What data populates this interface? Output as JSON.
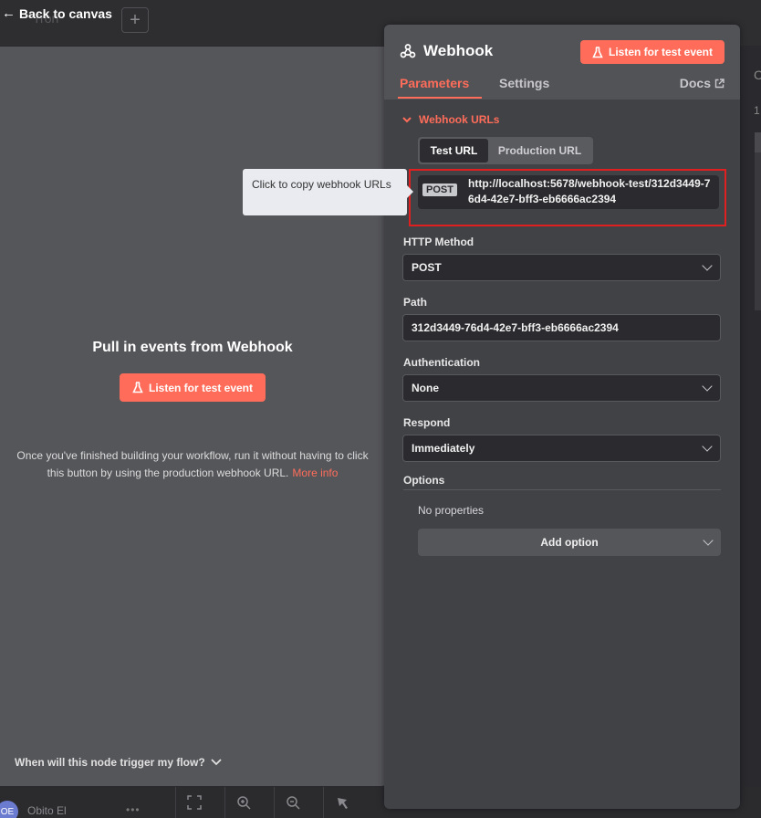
{
  "background": {
    "app_name": "Tron",
    "plus_icon": "plus-icon",
    "right_partial_letter": "C",
    "right_partial_number": "1",
    "user": {
      "initials": "OE",
      "name": "Obito El",
      "menu_icon": "more-dots-icon"
    },
    "canvas_tools": [
      "fit-view-icon",
      "zoom-in-icon",
      "zoom-out-icon",
      "tidy-up-icon"
    ]
  },
  "back_link": {
    "label": "Back to canvas",
    "icon": "arrow-left-icon"
  },
  "input_panel": {
    "title": "Pull in events from Webhook",
    "listen_button": "Listen for test event",
    "info_text": "Once you've finished building your workflow, run it without having to click this button by using the production webhook URL.",
    "more_info_link": "More info",
    "footer_question": "When will this node trigger my flow?"
  },
  "node": {
    "title": "Webhook",
    "icon": "webhook-icon",
    "listen_button": "Listen for test event",
    "tabs": [
      {
        "label": "Parameters",
        "active": true
      },
      {
        "label": "Settings",
        "active": false
      }
    ],
    "docs_label": "Docs",
    "webhook_urls": {
      "section_label": "Webhook URLs",
      "switch_options": [
        "Test URL",
        "Production URL"
      ],
      "selected": "Test URL",
      "method": "POST",
      "url": "http://localhost:5678/webhook-test/312d3449-76d4-42e7-bff3-eb6666ac2394"
    },
    "tooltip": "Click to copy webhook URLs",
    "fields": {
      "http_method": {
        "label": "HTTP Method",
        "value": "POST"
      },
      "path": {
        "label": "Path",
        "value": "312d3449-76d4-42e7-bff3-eb6666ac2394"
      },
      "authentication": {
        "label": "Authentication",
        "value": "None"
      },
      "respond": {
        "label": "Respond",
        "value": "Immediately"
      }
    },
    "options": {
      "label": "Options",
      "empty_text": "No properties",
      "add_button": "Add option"
    }
  },
  "colors": {
    "accent": "#ff6d5a",
    "highlight_border": "#e02020"
  }
}
